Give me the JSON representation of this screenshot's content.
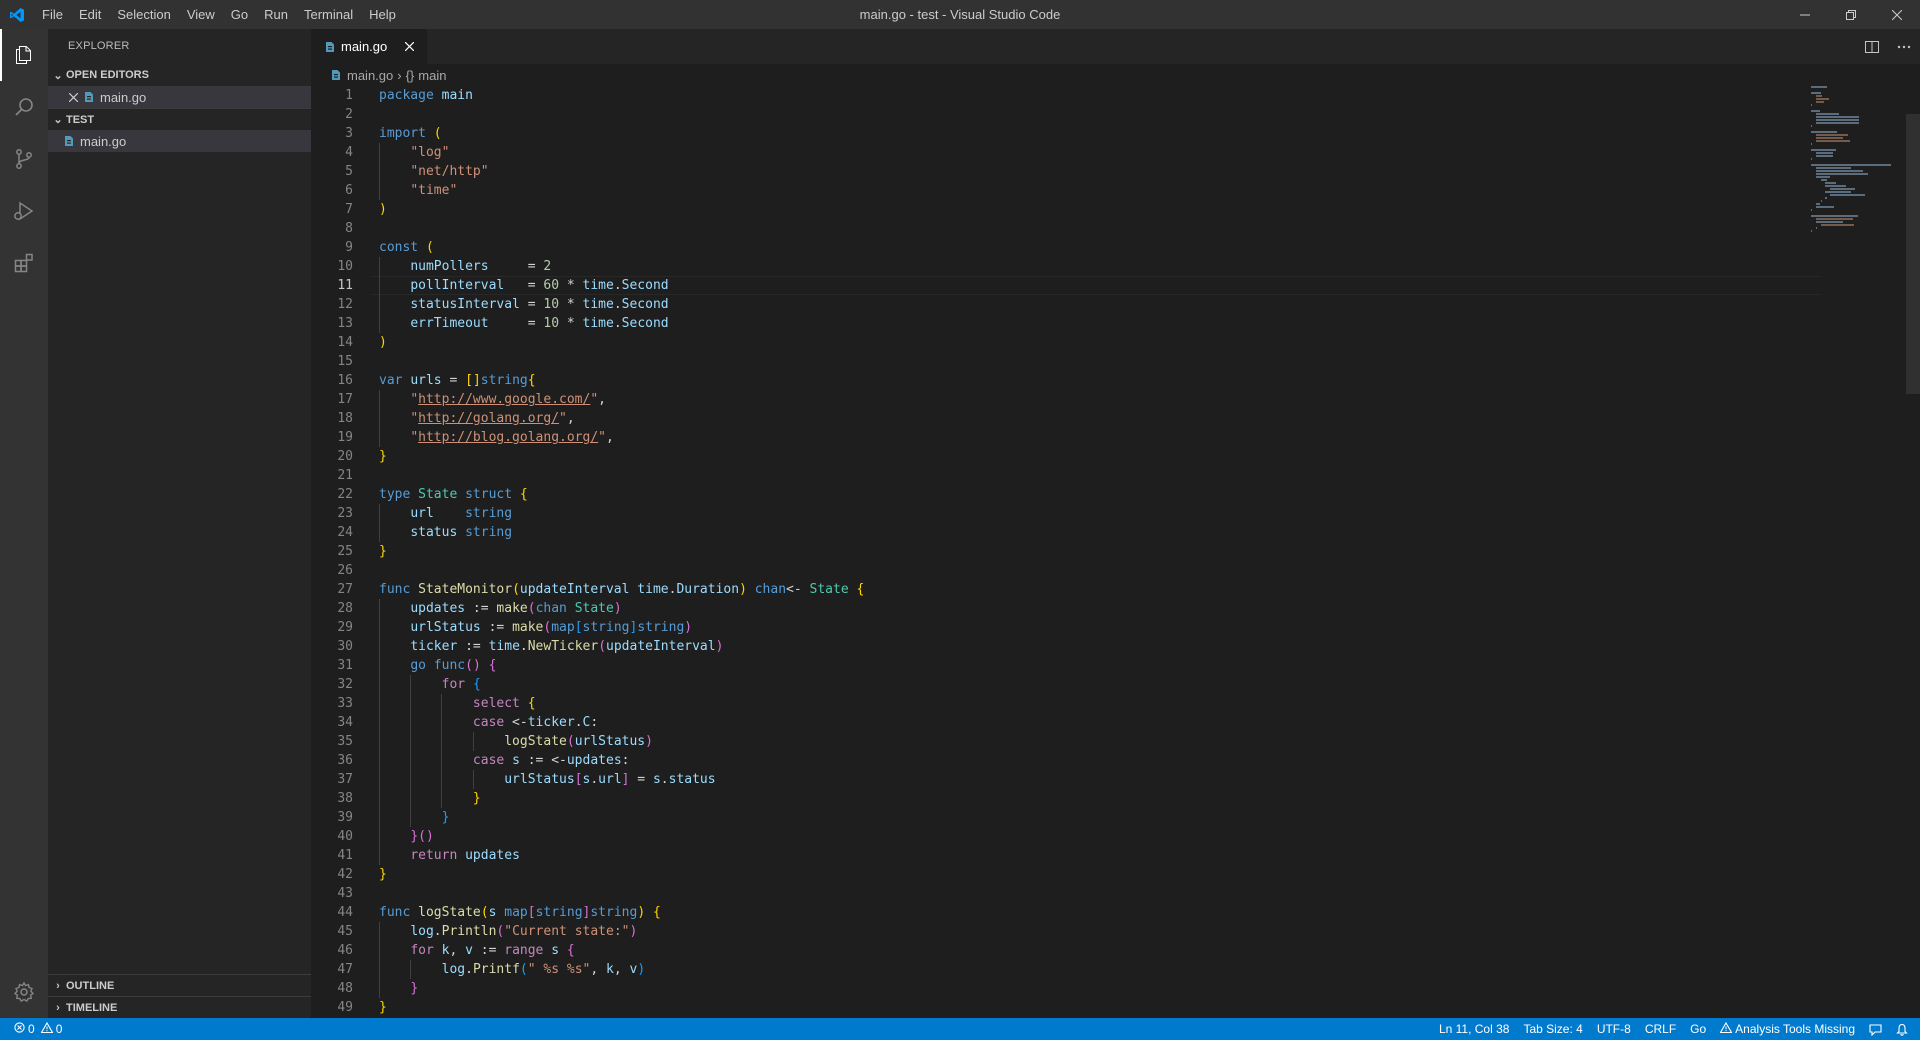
{
  "titlebar": {
    "title": "main.go - test - Visual Studio Code",
    "menu": [
      "File",
      "Edit",
      "Selection",
      "View",
      "Go",
      "Run",
      "Terminal",
      "Help"
    ]
  },
  "sidebar": {
    "title": "EXPLORER",
    "open_editors_label": "OPEN EDITORS",
    "open_editor_file": "main.go",
    "folder_label": "TEST",
    "folder_file": "main.go",
    "outline_label": "OUTLINE",
    "timeline_label": "TIMELINE"
  },
  "editor": {
    "tab_label": "main.go",
    "breadcrumb_file": "main.go",
    "breadcrumb_symbol": "main",
    "current_line": 11
  },
  "statusbar": {
    "errors": "0",
    "warnings": "0",
    "position": "Ln 11, Col 38",
    "tab_size": "Tab Size: 4",
    "encoding": "UTF-8",
    "eol": "CRLF",
    "language": "Go",
    "analysis": "Analysis Tools Missing"
  },
  "colors": {
    "statusbar": "#007acc",
    "activitybar": "#333333",
    "sidebar": "#252526",
    "editor": "#1e1e1e",
    "go_icon": "#519aba"
  },
  "code_lines": [
    "package main",
    "",
    "import (",
    "    \"log\"",
    "    \"net/http\"",
    "    \"time\"",
    ")",
    "",
    "const (",
    "    numPollers     = 2",
    "    pollInterval   = 60 * time.Second",
    "    statusInterval = 10 * time.Second",
    "    errTimeout     = 10 * time.Second",
    ")",
    "",
    "var urls = []string{",
    "    \"http://www.google.com/\",",
    "    \"http://golang.org/\",",
    "    \"http://blog.golang.org/\",",
    "}",
    "",
    "type State struct {",
    "    url    string",
    "    status string",
    "}",
    "",
    "func StateMonitor(updateInterval time.Duration) chan<- State {",
    "    updates := make(chan State)",
    "    urlStatus := make(map[string]string)",
    "    ticker := time.NewTicker(updateInterval)",
    "    go func() {",
    "        for {",
    "            select {",
    "            case <-ticker.C:",
    "                logState(urlStatus)",
    "            case s := <-updates:",
    "                urlStatus[s.url] = s.status",
    "            }",
    "        }",
    "    }()",
    "    return updates",
    "}",
    "",
    "func logState(s map[string]string) {",
    "    log.Println(\"Current state:\")",
    "    for k, v := range s {",
    "        log.Printf(\" %s %s\", k, v)",
    "    }",
    "}"
  ]
}
